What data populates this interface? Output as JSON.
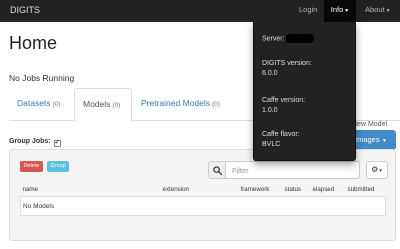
{
  "navbar": {
    "brand": "DIGITS",
    "login": "Login",
    "info": "Info",
    "about": "About"
  },
  "info_dropdown": {
    "server_label": "Server:",
    "digits_version_label": "DIGITS version:",
    "digits_version": "6.0.0",
    "caffe_version_label": "Caffe version:",
    "caffe_version": "1.0.0",
    "caffe_flavor_label": "Caffe flavor:",
    "caffe_flavor": "BVLC"
  },
  "page": {
    "title": "Home",
    "status": "No Jobs Running"
  },
  "tabs": [
    {
      "label": "Datasets",
      "count": "(0)"
    },
    {
      "label": "Models",
      "count": "(0)"
    },
    {
      "label": "Pretrained Models",
      "count": "(0)"
    }
  ],
  "group_jobs": {
    "label": "Group Jobs:",
    "checked": "✓"
  },
  "new_model": {
    "label": "New Model",
    "images_button": "Images"
  },
  "toolbar": {
    "delete_label": "Delete",
    "group_label": "Group",
    "filter_placeholder": "Filter"
  },
  "table": {
    "columns": [
      "name",
      "extension",
      "framework",
      "status",
      "elapsed",
      "submitted"
    ],
    "empty_message": "No Models"
  },
  "colors": {
    "navbar": "#222222",
    "link": "#337ab7",
    "primary": "#428bca",
    "danger": "#d9534f",
    "info": "#5bc0de"
  }
}
